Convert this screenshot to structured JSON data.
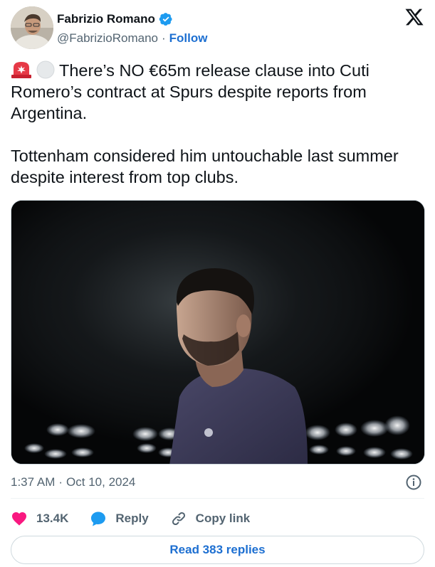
{
  "author": {
    "display_name": "Fabrizio Romano",
    "handle": "@FabrizioRomano",
    "separator": "·",
    "follow_label": "Follow"
  },
  "tweet": {
    "paragraph_1": "There’s NO €65m release clause into Cuti Romero’s contract at Spurs despite reports from Argentina.",
    "paragraph_2": "Tottenham considered him untouchable last summer despite interest from top clubs.",
    "emojis": [
      "siren-emoji",
      "white-circle-emoji"
    ]
  },
  "meta": {
    "time": "1:37 AM",
    "separator": "·",
    "date": "Oct 10, 2024"
  },
  "actions": {
    "likes_count": "13.4K",
    "reply_label": "Reply",
    "copy_link_label": "Copy link"
  },
  "read_replies_label": "Read 383 replies",
  "colors": {
    "link_blue": "#1d6fd1",
    "like_red": "#f91880",
    "reply_blue": "#1d9bf0",
    "verified_blue": "#1d9bf0",
    "text_secondary": "#536471"
  },
  "icons": {
    "verified": "verified-badge-icon",
    "logo": "x-logo-icon",
    "info": "info-icon",
    "like": "heart-icon",
    "reply": "speech-bubble-icon",
    "copy_link": "link-icon"
  }
}
